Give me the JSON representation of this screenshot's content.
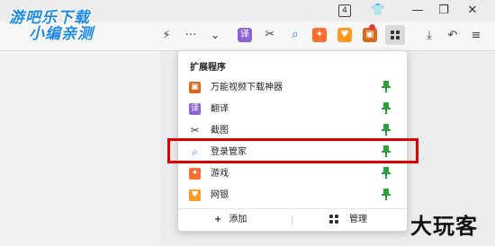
{
  "watermark": {
    "line1": "游吧乐下载",
    "line2": "小编亲测"
  },
  "titlebar": {
    "tab_count": "4"
  },
  "toolbar": {
    "extensions": [
      {
        "name": "translate",
        "glyph": "译",
        "color": "#8e63d6"
      },
      {
        "name": "screenshot",
        "glyph": "✂",
        "color": "#444444"
      },
      {
        "name": "search",
        "glyph": "⌕",
        "color": "#2a6de0"
      },
      {
        "name": "game",
        "glyph": "✦",
        "color": "#ff6d2d"
      },
      {
        "name": "bank",
        "glyph": "♥",
        "color": "#ff9a1f"
      },
      {
        "name": "video",
        "glyph": "▣",
        "color": "#d86a1c"
      }
    ]
  },
  "popup": {
    "title": "扩展程序",
    "items": [
      {
        "label": "万能视频下载神器",
        "icon": "video-download-icon",
        "glyph": "▣",
        "color": "#d86a1c"
      },
      {
        "label": "翻译",
        "icon": "translate-icon",
        "glyph": "译",
        "color": "#8e63d6"
      },
      {
        "label": "截图",
        "icon": "scissors-icon",
        "glyph": "✂",
        "color": "#444444"
      },
      {
        "label": "登录管家",
        "icon": "login-search-icon",
        "glyph": "⌕",
        "color": "#2a6de0"
      },
      {
        "label": "游戏",
        "icon": "gamepad-icon",
        "glyph": "✦",
        "color": "#ff6d2d"
      },
      {
        "label": "网银",
        "icon": "bank-shield-icon",
        "glyph": "♥",
        "color": "#ff9a1f"
      }
    ],
    "add_label": "添加",
    "manage_label": "管理",
    "pin_color": "#2e9e3f"
  },
  "highlight_color": "#e00000",
  "corner_logo": "大玩客"
}
